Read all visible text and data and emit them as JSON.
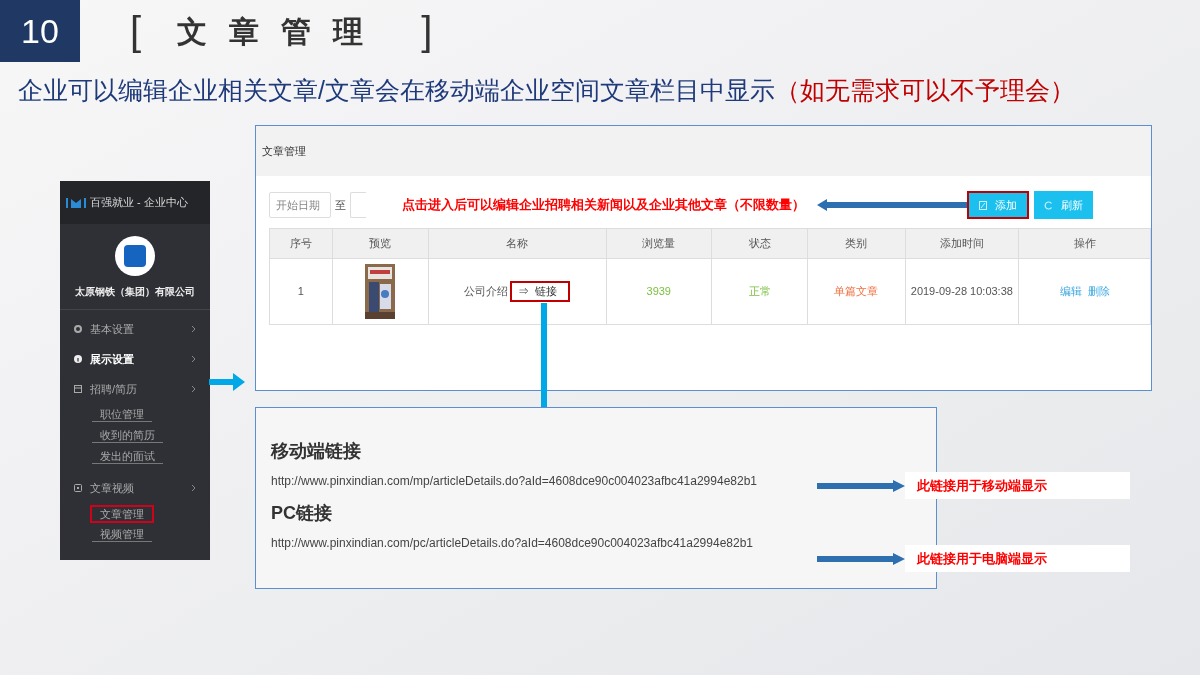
{
  "slide": {
    "number": "10",
    "bracket_open": "[",
    "title": "文章管理",
    "bracket_close": "]"
  },
  "subtitle": {
    "main": "企业可以编辑企业相关文章/文章会在移动端企业空间文章栏目中显示",
    "note": "（如无需求可以不予理会）"
  },
  "sidebar": {
    "brand": "百强就业 - 企业中心",
    "company": "太原钢铁（集团）有限公司",
    "items": [
      {
        "label": "基本设置",
        "kind": "gear",
        "bright": false
      },
      {
        "label": "展示设置",
        "kind": "info",
        "bright": true
      },
      {
        "label": "招聘/简历",
        "kind": "table",
        "bright": false,
        "children": [
          {
            "label": "职位管理",
            "highlighted": false
          },
          {
            "label": "收到的简历",
            "highlighted": false
          },
          {
            "label": "发出的面试",
            "highlighted": false
          }
        ]
      },
      {
        "label": "文章视频",
        "kind": "video",
        "bright": false,
        "children": [
          {
            "label": "文章管理",
            "highlighted": true
          },
          {
            "label": "视频管理",
            "highlighted": false
          }
        ]
      }
    ]
  },
  "article_panel": {
    "title": "文章管理",
    "date_start": {
      "placeholder": "开始日期"
    },
    "date_separator": "至",
    "annotation": "点击进入后可以编辑企业招聘相关新闻以及企业其他文章（不限数量）",
    "buttons": [
      {
        "label": "添加",
        "kind": "edit",
        "highlighted": true
      },
      {
        "label": "刷新",
        "kind": "refresh",
        "highlighted": false
      }
    ],
    "table": {
      "columns": [
        "序号",
        "预览",
        "名称",
        "浏览量",
        "状态",
        "类别",
        "添加时间",
        "操作"
      ],
      "rows": [
        {
          "index": "1",
          "preview": {
            "kind": "picture"
          },
          "name": "公司介绍",
          "link": "⇒  链接",
          "views": "3939",
          "status": "正常",
          "category": "单篇文章",
          "added": "2019-09-28 10:03:38",
          "actions": [
            "编辑",
            "删除"
          ]
        }
      ]
    }
  },
  "links_panel": {
    "sections": [
      {
        "heading": "移动端链接",
        "url": "http://www.pinxindian.com/mp/articleDetails.do?aId=4608dce90c004023afbc41a2994e82b1",
        "note": "此链接用于移动端显示"
      },
      {
        "heading": "PC链接",
        "url": "http://www.pinxindian.com/pc/articleDetails.do?aId=4608dce90c004023afbc41a2994e82b1",
        "note": "此链接用于电脑端显示"
      }
    ]
  }
}
